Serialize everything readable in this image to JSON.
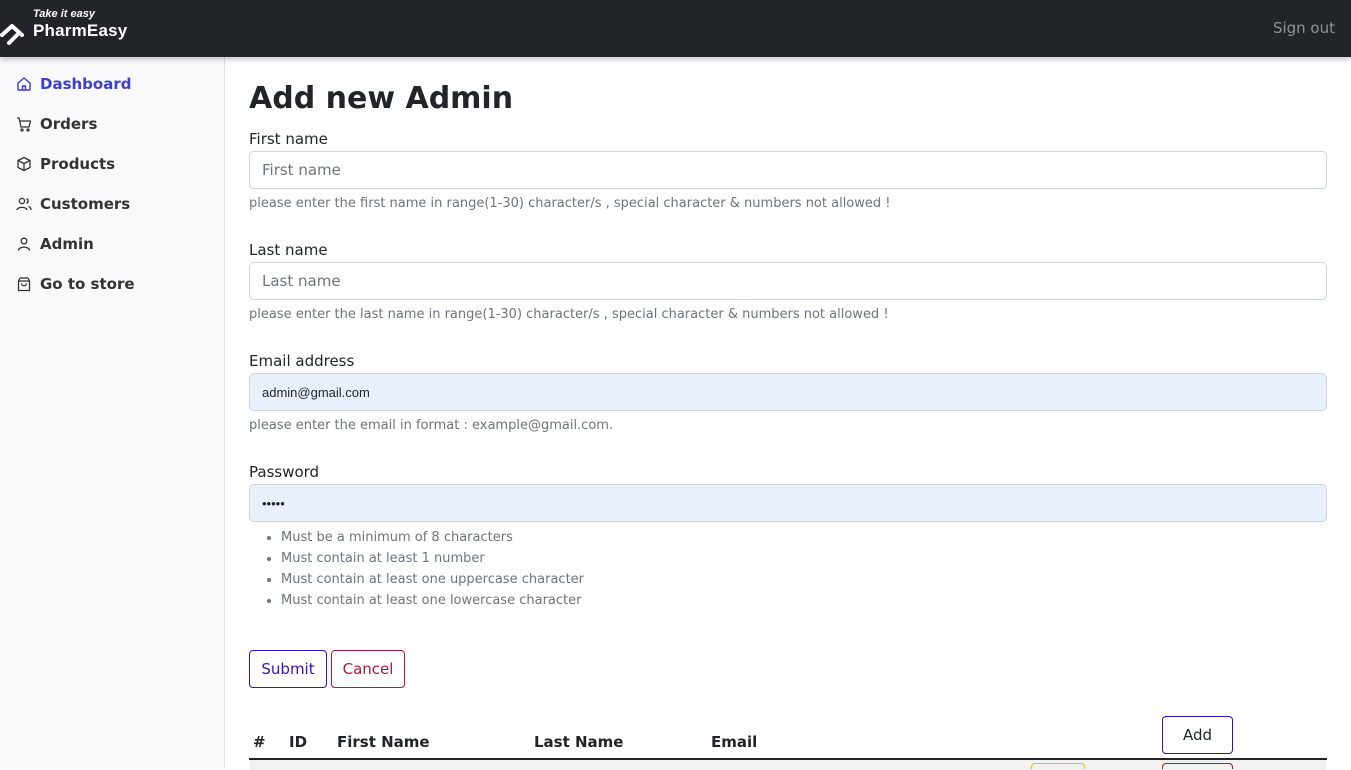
{
  "header": {
    "brand_tagline": "Take it easy",
    "brand_name": "PharmEasy",
    "signout_label": "Sign out"
  },
  "sidebar": {
    "items": [
      {
        "label": "Dashboard",
        "icon": "home-icon",
        "active": true
      },
      {
        "label": "Orders",
        "icon": "cart-icon"
      },
      {
        "label": "Products",
        "icon": "box-icon"
      },
      {
        "label": "Customers",
        "icon": "users-icon"
      },
      {
        "label": "Admin",
        "icon": "user-icon"
      },
      {
        "label": "Go to store",
        "icon": "bag-icon"
      }
    ]
  },
  "form": {
    "title": "Add new Admin",
    "first_name": {
      "label": "First name",
      "placeholder": "First name",
      "help": "please enter the first name in range(1-30) character/s , special character & numbers not allowed !"
    },
    "last_name": {
      "label": "Last name",
      "placeholder": "Last name",
      "help": "please enter the last name in range(1-30) character/s , special character & numbers not allowed !"
    },
    "email": {
      "label": "Email address",
      "value": "admin@gmail.com",
      "help": "please enter the email in format : example@gmail.com."
    },
    "password": {
      "label": "Password",
      "value": "•••••",
      "rules": [
        "Must be a minimum of 8 characters",
        "Must contain at least 1 number",
        "Must contain at least one uppercase character",
        "Must contain at least one lowercase character"
      ]
    },
    "submit_label": "Submit",
    "cancel_label": "Cancel"
  },
  "table": {
    "columns": [
      "#",
      "ID",
      "First Name",
      "Last Name",
      "Email"
    ],
    "add_label": "Add"
  },
  "colors": {
    "topbar": "#212529",
    "active_nav": "#3e3fd1",
    "primary_outline": "#3b0fbf",
    "danger_outline": "#b0193d"
  }
}
